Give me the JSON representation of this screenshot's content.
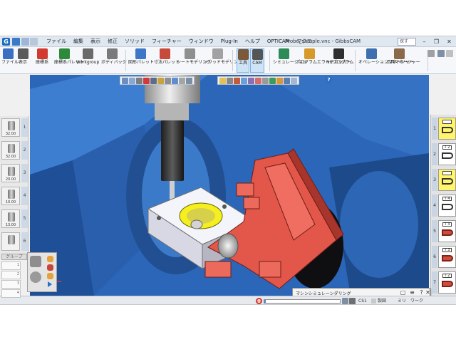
{
  "window": {
    "title": "Probe_sample.vnc - GibbsCAM",
    "search_value": "探す",
    "menus": [
      "ファイル",
      "編集",
      "表示",
      "修正",
      "ソリッド",
      "フィーチャー",
      "ウィンドウ",
      "Plug-In",
      "ヘルプ",
      "OPTICAM",
      "マクロ"
    ]
  },
  "ribbon": {
    "buttons": [
      {
        "label": "ファイル"
      },
      {
        "label": "表示"
      },
      {
        "label": "座標系"
      },
      {
        "label": "座標系パレット"
      },
      {
        "label": "Workgroup"
      },
      {
        "label": "ボディバッグ"
      },
      {
        "label": "図形パレット"
      },
      {
        "label": "寸法パレット"
      },
      {
        "label": "シートモデリング"
      },
      {
        "label": "ソリッドモデリング"
      },
      {
        "label": "工具"
      },
      {
        "label": "CAM"
      },
      {
        "label": "シミュレーション"
      },
      {
        "label": "プログラムエラーチェッカー"
      },
      {
        "label": "NCプログラム"
      },
      {
        "label": "オペレーションマネージャー"
      },
      {
        "label": "工具マネージャー"
      }
    ]
  },
  "tools": [
    {
      "num": "1",
      "diameter": "32.00"
    },
    {
      "num": "2",
      "diameter": "32.00"
    },
    {
      "num": "3",
      "diameter": "20.00"
    },
    {
      "num": "4",
      "diameter": "10.00"
    },
    {
      "num": "5",
      "diameter": "13.00"
    },
    {
      "num": "6",
      "diameter": ""
    }
  ],
  "tool_group_label": "グループ",
  "slots": [
    "1",
    "2",
    "3",
    "4"
  ],
  "processes": [
    {
      "num": "1",
      "tag": "",
      "style": "yellow"
    },
    {
      "num": "2",
      "tag": "T 2",
      "style": "white"
    },
    {
      "num": "3",
      "tag": "",
      "style": "yellow"
    },
    {
      "num": "4",
      "tag": "T 4",
      "style": "white"
    },
    {
      "num": "5",
      "tag": "T 3",
      "style": "red"
    },
    {
      "num": "6",
      "tag": "T 3",
      "style": "red"
    },
    {
      "num": "7",
      "tag": "T 2",
      "style": "red"
    }
  ],
  "simulation": {
    "title": "マシンシミュレーンダリング",
    "speed_fraction": 0.45
  },
  "status": {
    "progress_fraction": 0.02,
    "coord_label": "CS1",
    "mode_label": "製図",
    "unit_label": "ミリ",
    "work_label": "ワーク"
  },
  "colors": {
    "viewport_bg": "#2b66b8",
    "fixture": "#e2574a",
    "fixture_dark": "#a8352b",
    "part_face": "#e8e8f2",
    "pocket": "#f4ee2a",
    "accent": "#2a78d6"
  }
}
